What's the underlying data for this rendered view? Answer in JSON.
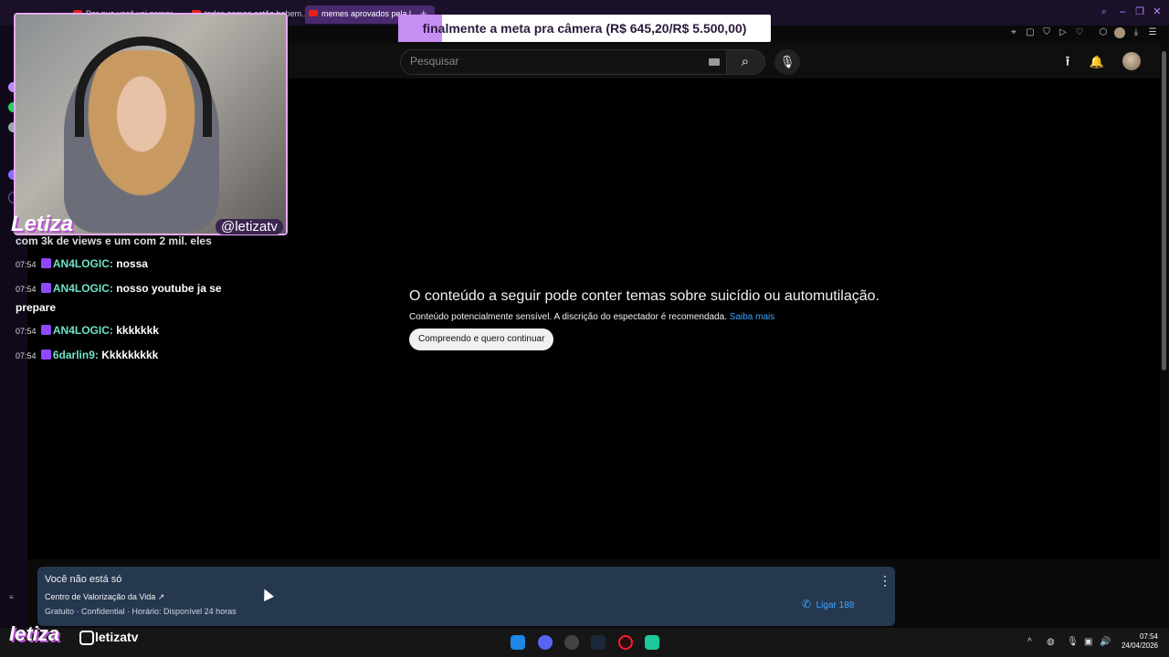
{
  "browser": {
    "tabs": [
      {
        "label": "Por que você vai gamar..."
      },
      {
        "label": "todos gamas estão bebem..."
      },
      {
        "label": "memes aprovados pela l..."
      }
    ],
    "new_tab_label": "+"
  },
  "goal": {
    "text": "finalmente a meta pra câmera (R$ 645,20/R$ 5.500,00)",
    "progress_fraction": 0.117
  },
  "webcam": {
    "name": "Letiza",
    "handle": "@letizatv"
  },
  "chat": {
    "partial_line": "com 3k de views e um com 2 mil. eles",
    "messages": [
      {
        "time": "07:54",
        "user": "AN4LOGIC",
        "text": "nossa"
      },
      {
        "time": "07:54",
        "user": "AN4LOGIC",
        "text": "nosso youtube ja se prepare"
      },
      {
        "time": "07:54",
        "user": "AN4LOGIC",
        "text": "kkkkkkk"
      },
      {
        "time": "07:54",
        "user": "6darlin9",
        "text": "Kkkkkkkkk"
      }
    ]
  },
  "youtube": {
    "search": {
      "placeholder": "Pesquisar"
    },
    "warning": {
      "title": "O conteúdo a seguir pode conter temas sobre suicídio ou automutilação.",
      "subtitle": "Conteúdo potencialmente sensível. A discrição do espectador é recomendada.",
      "link": "Saiba mais",
      "button": "Compreendo e quero continuar"
    },
    "help_panel": {
      "title": "Você não está só",
      "org": "Centro de Valorização da Vida ↗",
      "meta": "Gratuito · Confidential · Horário: Disponível 24 horas",
      "call": "Ligar 188"
    }
  },
  "overlay": {
    "logo": "letiza",
    "instagram": "letizatv"
  },
  "taskbar": {
    "time": "07:54",
    "date": "24/04/2026"
  },
  "colors": {
    "accent": "#c78ef4",
    "link": "#3ea6ff",
    "chat_user": "#6fe3c8",
    "help_bg": "#263850"
  }
}
